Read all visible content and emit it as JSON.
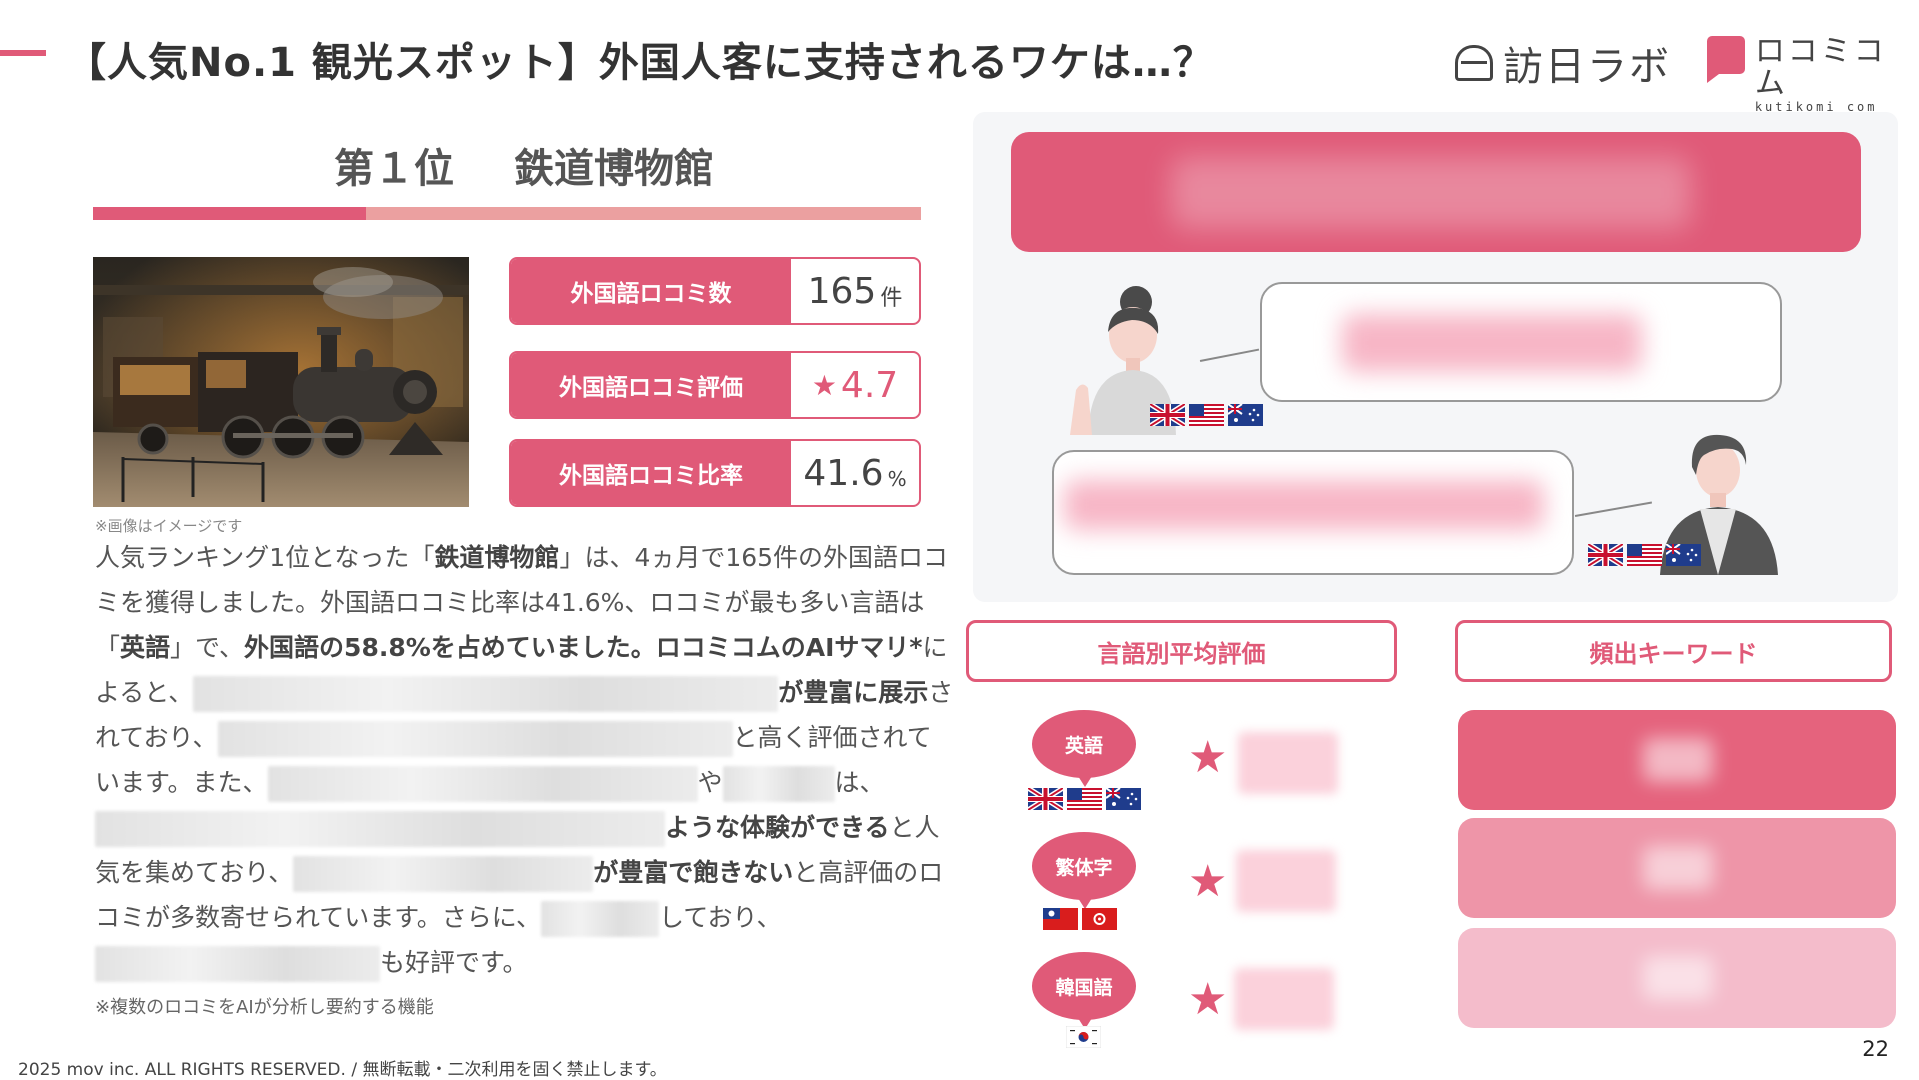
{
  "header": {
    "title": "【人気No.1 観光スポット】外国人客に支持されるワケは…？",
    "logo_houmon": "訪日ラボ",
    "logo_kuchikomi": "ロコミコム",
    "logo_kuchikomi_sub": "kutikomi com"
  },
  "ranking": {
    "rank_label": "第１位",
    "place_name": "鉄道博物館",
    "progress_fraction": 0.33
  },
  "photo": {
    "note": "※画像はイメージです"
  },
  "stats": [
    {
      "label": "外国語ロコミ数",
      "value": "165",
      "unit": "件"
    },
    {
      "label": "外国語ロコミ評価",
      "value": "4.7",
      "icon": "star-icon"
    },
    {
      "label": "外国語ロコミ比率",
      "value": "41.6",
      "unit": "%"
    }
  ],
  "paragraph": {
    "t1": "人気ランキング1位となった「",
    "b1": "鉄道博物館",
    "t2": "」は、4ヵ月で165件の外国語ロコミを獲得しました。外国語ロコミ比率は41.6%、ロコミが最も多い言語は「",
    "b2": "英語",
    "t3": "」で、",
    "b3": "外国語の58.8%を占めていました。ロコミコムのAIサマリ*",
    "t4": "によると、",
    "b4": "が豊富に展示",
    "t5": "されており、",
    "t6": "と高く評価されています。また、",
    "t7": "や",
    "t8": "は、",
    "b5": "ような体験ができる",
    "t9": "と人気を集めており、",
    "b6": "が豊富で飽きない",
    "t10": "と高評価のロコミが多数寄せられています。さらに、",
    "t11": "しており、",
    "t12": "も好評です。"
  },
  "footnote": "※複数のロコミをAIが分析し要約する機能",
  "copyright": "2025 mov inc. ALL RIGHTS RESERVED. / 無断転載・二次利用を固く禁止します。",
  "page_number": "22",
  "sections": {
    "avg_rating": "言語別平均評価",
    "keywords": "頻出キーワード"
  },
  "languages": [
    {
      "label": "英語",
      "flags": [
        "uk-flag-icon",
        "us-flag-icon",
        "au-flag-icon"
      ]
    },
    {
      "label": "繁体字",
      "flags": [
        "tw-flag-icon",
        "hk-flag-icon"
      ]
    },
    {
      "label": "韓国語",
      "flags": [
        "kr-flag-icon"
      ]
    }
  ],
  "colors": {
    "accent": "#e05a78",
    "accent_light": "#eba0a0",
    "keyword_1": "#e5637d",
    "keyword_2": "#ee95a8",
    "keyword_3": "#f4bccb",
    "panel_bg": "#f5f6f8"
  }
}
